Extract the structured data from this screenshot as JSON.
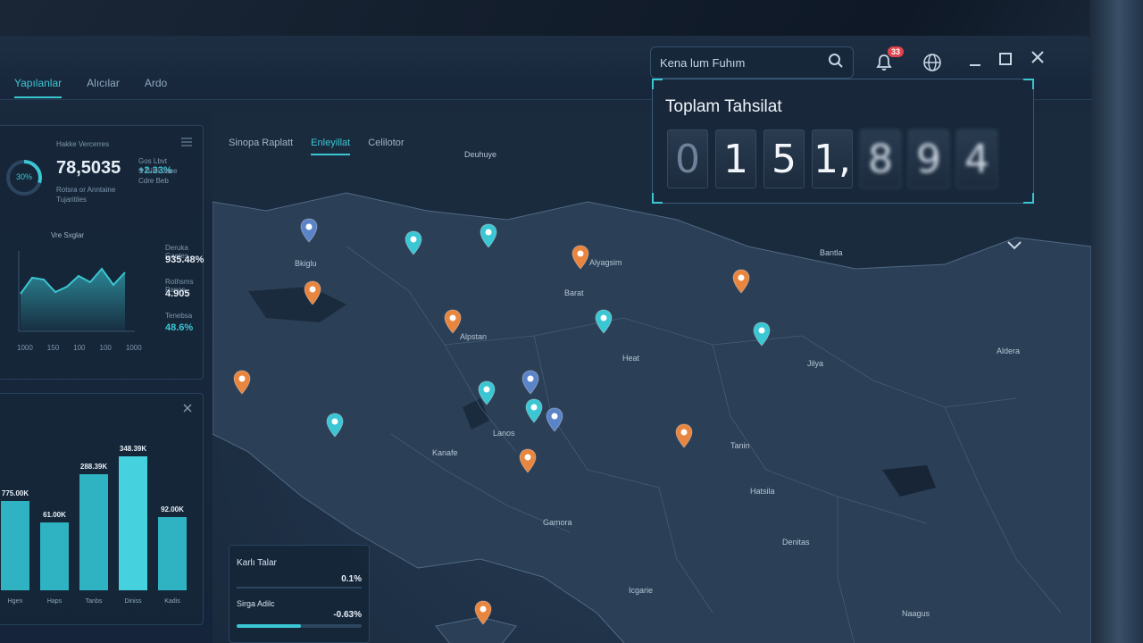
{
  "header": {
    "tabs": [
      {
        "label": "Yapılanlar",
        "active": true
      },
      {
        "label": "Alıcılar",
        "active": false
      },
      {
        "label": "Ardo",
        "active": false
      }
    ],
    "search": {
      "value": "Kena lum Fuhım"
    },
    "notifications": {
      "count": "33"
    }
  },
  "kpi": {
    "ring": "30%",
    "caption": "Hakke Vercerres",
    "value": "78,5035",
    "desc": "Rotsra or Anntaine Tujaritiles",
    "change": "+2.33%",
    "note": "Gos Lbvt\nS Gilth Jaoe\nCdre Beb",
    "legend": "Vre Sxglar",
    "xticks": [
      "1000",
      "150",
      "100",
      "100",
      "1000"
    ],
    "stats": [
      {
        "label": "Deruka Gaetes",
        "value": "935.48%"
      },
      {
        "label": "Rothsms Panos",
        "value": "4.905"
      },
      {
        "label": "Tenebsa",
        "value": "48.6%"
      }
    ],
    "line": [
      42,
      60,
      58,
      44,
      50,
      62,
      55,
      70,
      52,
      66
    ]
  },
  "bars": {
    "labels": [
      "775.00K",
      "61.00K",
      "288.39K",
      "348.39K",
      "92.00K"
    ],
    "categories": [
      "Hgen",
      "Haps",
      "Tanbs",
      "Diniss",
      "Kadis"
    ],
    "values": [
      100,
      76,
      130,
      150,
      82
    ]
  },
  "bottom_panel": {
    "rows": [
      {
        "label": "Karlı Talar",
        "value": "0.1%"
      },
      {
        "label": "Sirga Adilc",
        "value": "-0.63%"
      }
    ]
  },
  "map": {
    "tabs": [
      {
        "label": "Sinopa Raplatt",
        "active": false
      },
      {
        "label": "Enleyillat",
        "active": true
      },
      {
        "label": "Celilotor",
        "active": false
      }
    ],
    "center_label": "Deuhuye",
    "cities": [
      {
        "name": "Bkiglu"
      },
      {
        "name": "Alyagsim"
      },
      {
        "name": "Barat"
      },
      {
        "name": "Alpstan"
      },
      {
        "name": "Heat"
      },
      {
        "name": "Jilya"
      },
      {
        "name": "Bantla"
      },
      {
        "name": "Aldera"
      },
      {
        "name": "Tanin"
      },
      {
        "name": "Lanos"
      },
      {
        "name": "Kanafe"
      },
      {
        "name": "Gamora"
      },
      {
        "name": "Hatsila"
      },
      {
        "name": "Denitas"
      },
      {
        "name": "Icgarie"
      },
      {
        "name": "Naagus"
      }
    ]
  },
  "tahsilat": {
    "title": "Toplam Tahsilat",
    "digits": [
      "0",
      "1",
      "5",
      "1,",
      "8",
      "9",
      "4"
    ]
  },
  "colors": {
    "accent": "#3ac6d3",
    "orange": "#e8853f",
    "blue": "#5b84c8"
  }
}
